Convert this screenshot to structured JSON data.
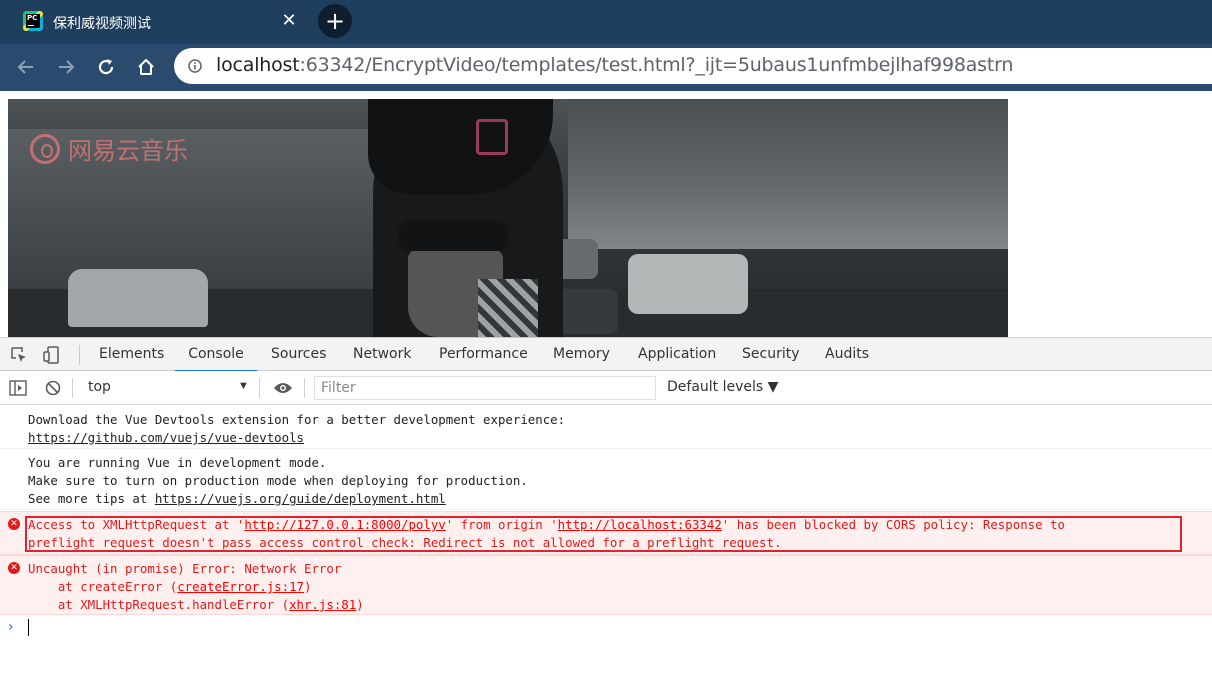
{
  "browser": {
    "tab_title": "保利威视频测试",
    "tab_close": "✕",
    "new_tab": "+",
    "url_host": "localhost",
    "url_rest": ":63342/EncryptVideo/templates/test.html?_ijt=5ubaus1unfmbejlhaf998astrn"
  },
  "video": {
    "watermark_text": "网易云音乐"
  },
  "devtools": {
    "tabs": [
      "Elements",
      "Console",
      "Sources",
      "Network",
      "Performance",
      "Memory",
      "Application",
      "Security",
      "Audits"
    ],
    "active_tab": "Console",
    "context": "top",
    "filter_placeholder": "Filter",
    "levels": "Default levels ▼"
  },
  "console": {
    "messages": [
      {
        "type": "log",
        "lines": [
          "Download the Vue Devtools extension for a better development experience:"
        ],
        "link": "https://github.com/vuejs/vue-devtools"
      },
      {
        "type": "log",
        "lines": [
          "You are running Vue in development mode.",
          "Make sure to turn on production mode when deploying for production."
        ],
        "prefix": "See more tips at ",
        "link": "https://vuejs.org/guide/deployment.html"
      },
      {
        "type": "error",
        "part1": "Access to XMLHttpRequest at '",
        "link1": "http://127.0.0.1:8000/polyv",
        "part2": "' from origin '",
        "link2": "http://localhost:63342",
        "part3": "' has been blocked by CORS policy: Response to",
        "line2": "preflight request doesn't pass access control check: Redirect is not allowed for a preflight request."
      },
      {
        "type": "error",
        "line1": "Uncaught (in promise) Error: Network Error",
        "frame1_prefix": "    at createError (",
        "frame1_link": "createError.js:17",
        "frame1_suffix": ")",
        "frame2_prefix": "    at XMLHttpRequest.handleError (",
        "frame2_link": "xhr.js:81",
        "frame2_suffix": ")"
      }
    ],
    "prompt": "›"
  },
  "colors": {
    "tabstrip": "#1f3d5c",
    "toolbar": "#2a4a6e",
    "accent": "#1a73e8",
    "error_text": "#e41a1a",
    "error_bg": "#fff0f0",
    "highlight": "#e0232f"
  }
}
